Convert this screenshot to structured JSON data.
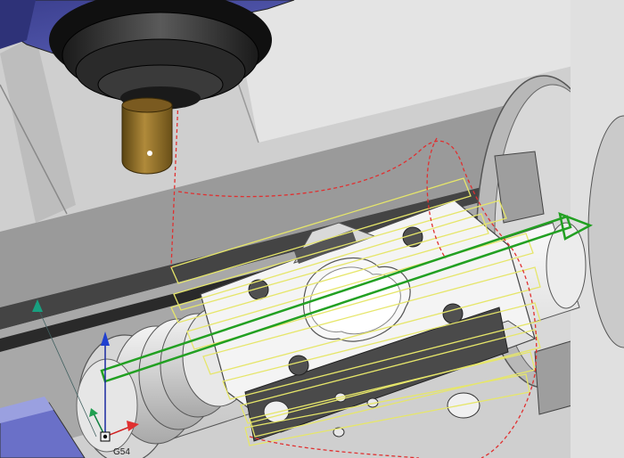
{
  "viewport": {
    "wcs_label": "G54"
  },
  "colors": {
    "background": "#c8c8c8",
    "machine_head": "#4a4f9e",
    "tool_holder": "#8a6a2a",
    "workpiece": "#f2f2f2",
    "toolpath_outline": "#e8e86a",
    "toolpath_motion": "#22a022",
    "rapid_move": "#e03030"
  },
  "icons": {
    "axis_triad": "xyz-axis-triad-icon",
    "motion_arrow": "arrow-right-icon"
  }
}
